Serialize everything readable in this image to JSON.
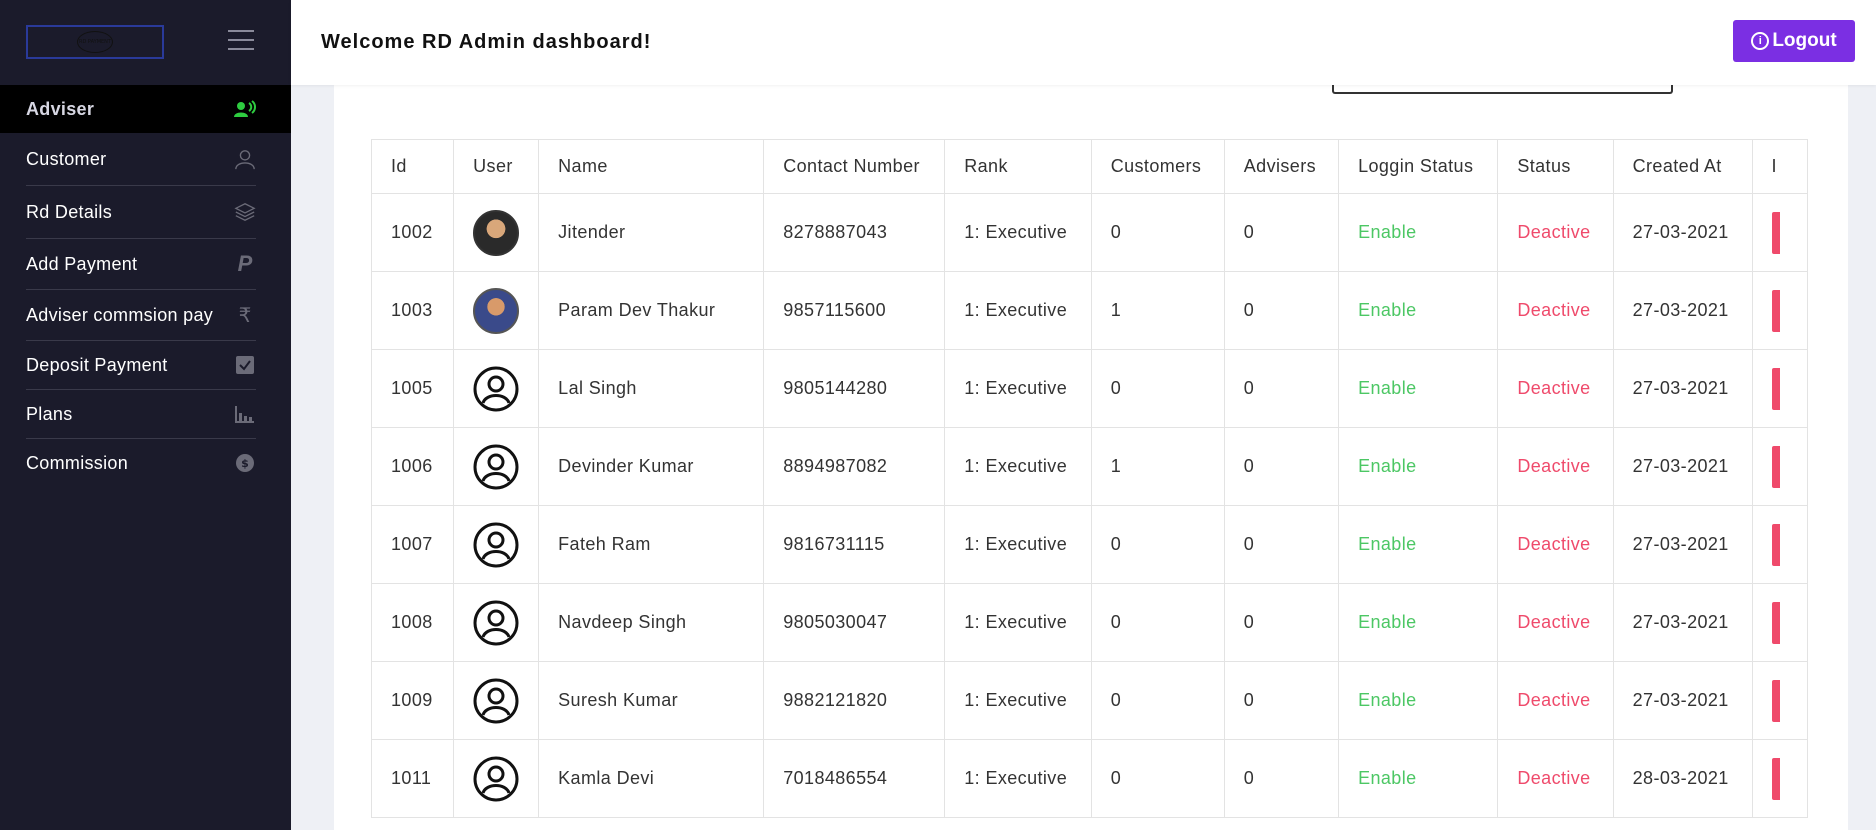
{
  "sidebar": {
    "logo_text": "RD PAYMENT",
    "items": [
      {
        "label": "Adviser",
        "icon": "adviser-icon",
        "active": true
      },
      {
        "label": "Customer",
        "icon": "user-outline-icon"
      },
      {
        "label": "Rd Details",
        "icon": "layers-icon"
      },
      {
        "label": "Add Payment",
        "icon": "paypal-icon"
      },
      {
        "label": "Adviser commsion pay",
        "icon": "rupee-icon"
      },
      {
        "label": "Deposit Payment",
        "icon": "checkbox-icon"
      },
      {
        "label": "Plans",
        "icon": "chart-icon"
      },
      {
        "label": "Commission",
        "icon": "dollar-circle-icon"
      }
    ]
  },
  "header": {
    "welcome": "Welcome RD Admin dashboard!",
    "logout_label": "Logout"
  },
  "table": {
    "columns": [
      "Id",
      "User",
      "Name",
      "Contact Number",
      "Rank",
      "Customers",
      "Advisers",
      "Loggin Status",
      "Status",
      "Created At",
      "I"
    ],
    "rows": [
      {
        "id": "1002",
        "avatar": "photo1",
        "name": "Jitender",
        "contact": "8278887043",
        "rank": "1: Executive",
        "customers": "0",
        "advisers": "0",
        "login": "Enable",
        "status": "Deactive",
        "created": "27-03-2021"
      },
      {
        "id": "1003",
        "avatar": "photo2",
        "name": "Param Dev Thakur",
        "contact": "9857115600",
        "rank": "1: Executive",
        "customers": "1",
        "advisers": "0",
        "login": "Enable",
        "status": "Deactive",
        "created": "27-03-2021"
      },
      {
        "id": "1005",
        "avatar": "default",
        "name": "Lal Singh",
        "contact": "9805144280",
        "rank": "1: Executive",
        "customers": "0",
        "advisers": "0",
        "login": "Enable",
        "status": "Deactive",
        "created": "27-03-2021"
      },
      {
        "id": "1006",
        "avatar": "default",
        "name": "Devinder Kumar",
        "contact": "8894987082",
        "rank": "1: Executive",
        "customers": "1",
        "advisers": "0",
        "login": "Enable",
        "status": "Deactive",
        "created": "27-03-2021"
      },
      {
        "id": "1007",
        "avatar": "default",
        "name": "Fateh Ram",
        "contact": "9816731115",
        "rank": "1: Executive",
        "customers": "0",
        "advisers": "0",
        "login": "Enable",
        "status": "Deactive",
        "created": "27-03-2021"
      },
      {
        "id": "1008",
        "avatar": "default",
        "name": "Navdeep Singh",
        "contact": "9805030047",
        "rank": "1: Executive",
        "customers": "0",
        "advisers": "0",
        "login": "Enable",
        "status": "Deactive",
        "created": "27-03-2021"
      },
      {
        "id": "1009",
        "avatar": "default",
        "name": "Suresh Kumar",
        "contact": "9882121820",
        "rank": "1: Executive",
        "customers": "0",
        "advisers": "0",
        "login": "Enable",
        "status": "Deactive",
        "created": "27-03-2021"
      },
      {
        "id": "1011",
        "avatar": "default",
        "name": "Kamla Devi",
        "contact": "7018486554",
        "rank": "1: Executive",
        "customers": "0",
        "advisers": "0",
        "login": "Enable",
        "status": "Deactive",
        "created": "28-03-2021"
      }
    ]
  },
  "colors": {
    "sidebar_bg": "#1b1b2b",
    "active_item_bg": "#000000",
    "logout_bg": "#7b2fe3",
    "enable": "#4cc764",
    "deactive": "#ef4a6b",
    "adviser_icon": "#2ecc40"
  }
}
